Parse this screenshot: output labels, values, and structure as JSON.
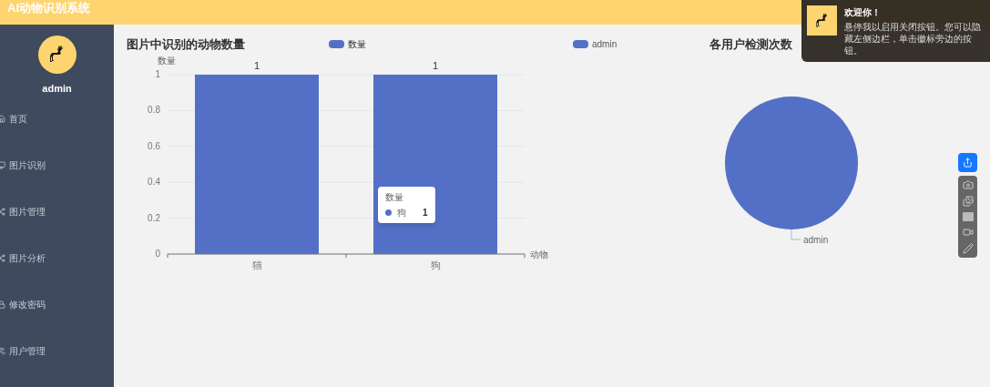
{
  "header": {
    "title": "AI动物识别系统"
  },
  "sidebar": {
    "user": "admin",
    "items": [
      {
        "label": "首页",
        "kind": "home"
      },
      {
        "label": "图片识别",
        "kind": "scan"
      },
      {
        "label": "图片管理",
        "kind": "manage"
      },
      {
        "label": "图片分析",
        "kind": "analyze"
      },
      {
        "label": "修改密码",
        "kind": "password"
      },
      {
        "label": "用户管理",
        "kind": "users"
      }
    ]
  },
  "bar_chart": {
    "chart_data": {
      "type": "bar",
      "title": "图片中识别的动物数量",
      "xlabel": "动物",
      "ylabel": "数量",
      "categories": [
        "猫",
        "狗"
      ],
      "series": [
        {
          "name": "数量",
          "color": "#5470c6",
          "values": [
            1,
            1
          ]
        }
      ],
      "ylim": [
        0,
        1
      ],
      "yticks": [
        0,
        0.2,
        0.4,
        0.6,
        0.8,
        1
      ],
      "grid": true,
      "data_labels": true
    },
    "tooltip": {
      "title": "数量",
      "name": "狗",
      "value": "1"
    }
  },
  "pie_chart": {
    "title": "各用户检测次数",
    "legend": [
      {
        "name": "admin",
        "color": "#5470c6"
      }
    ],
    "slices": [
      {
        "label": "admin",
        "color": "#5470c6"
      }
    ]
  },
  "toast": {
    "title": "欢迎你！",
    "message": "悬停我以启用关闭按钮。您可以隐藏左侧边栏，单击徽标旁边的按钮。"
  }
}
